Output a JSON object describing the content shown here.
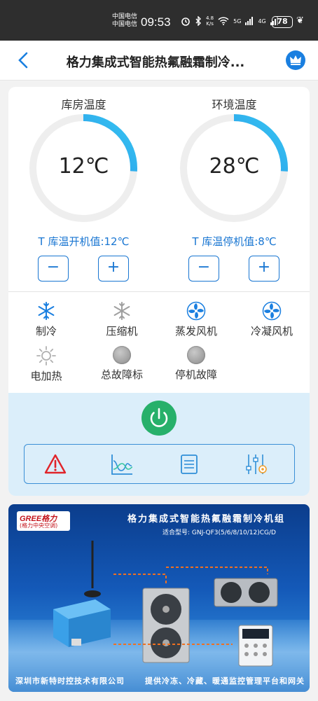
{
  "status_bar": {
    "carrier_line1": "中国电信",
    "carrier_line2": "中国电信",
    "time": "09:53",
    "speed_value": "4.8",
    "speed_unit": "K/s",
    "net1": "5G",
    "net2": "4G",
    "battery": "78"
  },
  "header": {
    "title": "格力集成式智能热氟融霜制冷...",
    "back_icon": "chevron-left-icon",
    "vip_icon": "crown-icon",
    "accent": "#1a7fe0"
  },
  "gauges": [
    {
      "title": "库房温度",
      "value": "12℃",
      "fill": 0.26,
      "setpoint": "T 库温开机值:12℃",
      "minus": "−",
      "plus": "+"
    },
    {
      "title": "环境温度",
      "value": "28℃",
      "fill": 0.26,
      "setpoint": "T 库温停机值:8℃",
      "minus": "−",
      "plus": "+"
    }
  ],
  "status_items": [
    {
      "label": "制冷",
      "icon": "snowflake-icon",
      "state": "active"
    },
    {
      "label": "压缩机",
      "icon": "snowflake-icon",
      "state": "inactive"
    },
    {
      "label": "蒸发风机",
      "icon": "fan-icon",
      "state": "active"
    },
    {
      "label": "冷凝风机",
      "icon": "fan-icon",
      "state": "active"
    },
    {
      "label": "电加热",
      "icon": "sun-icon",
      "state": "inactive"
    },
    {
      "label": "总故障标",
      "icon": "gray-dot-icon",
      "state": "inactive"
    },
    {
      "label": "停机故障",
      "icon": "gray-dot-icon",
      "state": "inactive"
    }
  ],
  "controls": {
    "power_icon": "power-icon",
    "power_color": "#27b06a",
    "tools": [
      "alarm-icon",
      "chart-icon",
      "list-icon",
      "settings-sliders-icon"
    ]
  },
  "banner": {
    "logo_text": "GREE格力",
    "logo_sub": "(格力中央空调)",
    "title": "格力集成式智能热氟融霜制冷机组",
    "model": "适合型号: GNJ-QF3(5/6/8/10/12)CG/D",
    "footer_left": "深圳市新特时控技术有限公司",
    "footer_right": "提供冷冻、冷藏、暖通监控管理平台和网关"
  }
}
